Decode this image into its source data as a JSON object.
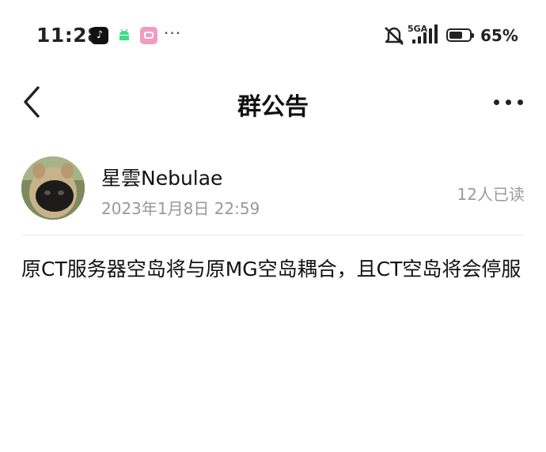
{
  "status_bar": {
    "time": "11:28",
    "tiktok_icon_glyph": "♪",
    "more_glyph": "···",
    "network_label": "5GA",
    "battery_percent": "65%",
    "battery_level": 0.65
  },
  "nav": {
    "title": "群公告"
  },
  "post": {
    "author": "星雲Nebulae",
    "datetime": "2023年1月8日 22:59",
    "read_count": "12人已读",
    "content": "原CT服务器空岛将与原MG空岛耦合，且CT空岛将会停服"
  },
  "colors": {
    "text": "#111111",
    "muted": "#999999",
    "divider": "#eaeaea"
  }
}
